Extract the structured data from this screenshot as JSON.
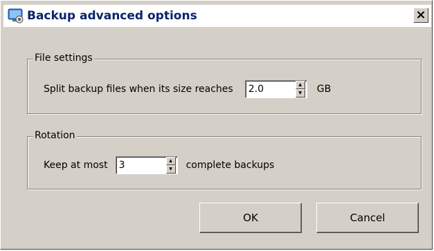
{
  "window": {
    "title": "Backup advanced options",
    "app_icon": "settings-computer-icon",
    "close_icon": "close-x-icon",
    "close_glyph": "×"
  },
  "file_settings": {
    "legend": "File settings",
    "prefix": "Split backup files when its size reaches",
    "value": "2.0",
    "unit": "GB"
  },
  "rotation": {
    "legend": "Rotation",
    "prefix": "Keep at most",
    "value": "3",
    "suffix": "complete backups"
  },
  "buttons": {
    "ok": "OK",
    "cancel": "Cancel"
  },
  "spinner": {
    "up_glyph": "▲",
    "down_glyph": "▼"
  }
}
